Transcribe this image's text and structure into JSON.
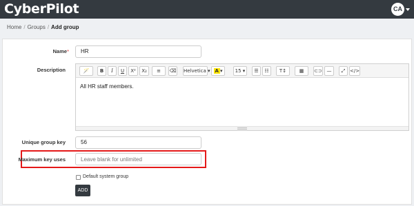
{
  "navbar": {
    "logo": "CyberPilot",
    "avatar_initials": "CA"
  },
  "breadcrumb": {
    "items": [
      "Home",
      "Groups"
    ],
    "current": "Add group",
    "separator": "/"
  },
  "form": {
    "name_label": "Name",
    "name_required_mark": "*",
    "name_value": "HR",
    "description_label": "Description",
    "description_value": "All HR staff members.",
    "unique_key_label": "Unique group key",
    "unique_key_value": "56",
    "max_uses_label": "Maximum key uses",
    "max_uses_placeholder": "Leave blank for unlimited",
    "default_system_group_label": "Default system group",
    "default_system_group_checked": false,
    "submit_label": "ADD"
  },
  "editor_toolbar": {
    "style": "🪄",
    "bold": "B",
    "italic": "I",
    "underline": "U",
    "superscript": "X²",
    "subscript": "X₂",
    "align": "≡",
    "clear_format": "⌫",
    "font_family": "Helvetica",
    "color": "A",
    "font_size": "15",
    "unordered_list": "☰",
    "ordered_list": "☷",
    "text_height": "T↕",
    "table": "▦",
    "link": "⊂⊃",
    "hr": "—",
    "fullscreen": "⤢",
    "code_view": "</>"
  },
  "colors": {
    "navbar_bg": "#343a40",
    "highlight_border": "#e41818",
    "text_highlight": "#ffe600",
    "button_bg": "#343a40"
  }
}
